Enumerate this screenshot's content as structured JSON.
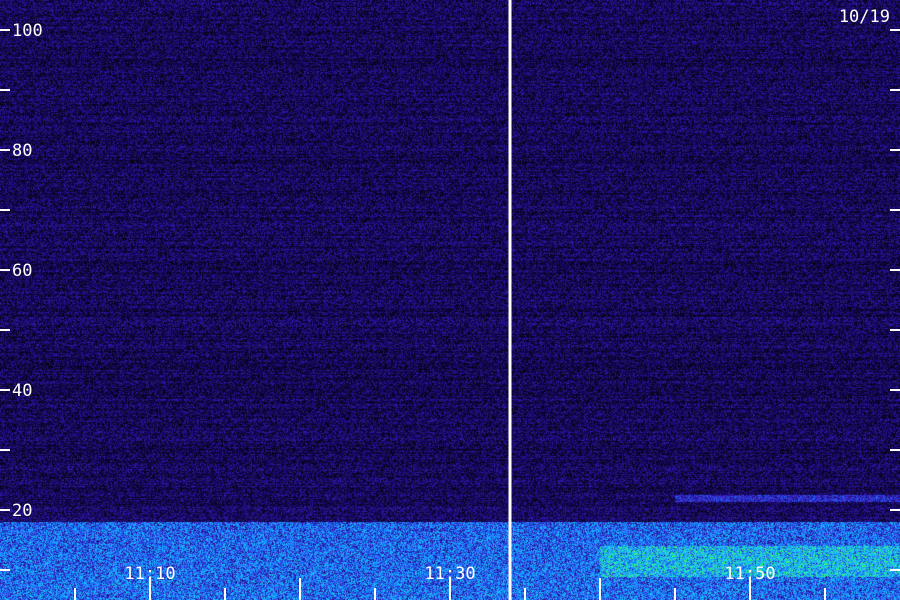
{
  "chart_data": {
    "type": "heatmap",
    "title": "",
    "date_label": "10/19",
    "xlabel": "",
    "ylabel": "",
    "x_tick_labels": [
      "11:10",
      "11:30",
      "11:50"
    ],
    "y_tick_labels": [
      "20",
      "40",
      "60",
      "80",
      "100"
    ],
    "y_ticks": [
      20,
      40,
      60,
      80,
      100
    ],
    "y_minor_ticks": [
      10,
      30,
      50,
      70,
      90
    ],
    "ylim": [
      5,
      105
    ],
    "x_major_ticks": [
      "11:10",
      "11:30",
      "11:50"
    ],
    "x_range": [
      "11:00",
      "12:00"
    ],
    "time_marker": "11:34",
    "colormap": [
      "#000000",
      "#1a0a6e",
      "#3a1cc0",
      "#1e6cff",
      "#18c8ff",
      "#39ff5a"
    ],
    "background_color": "#000000",
    "axis_color": "#ffffff",
    "bands": [
      {
        "name": "low-frequency noise (strong)",
        "y_from": 5,
        "y_to": 18,
        "x_from": "11:00",
        "x_to": "12:00",
        "level": 0.75
      },
      {
        "name": "green band",
        "y_from": 9,
        "y_to": 14,
        "x_from": "11:40",
        "x_to": "12:00",
        "level": 0.95
      },
      {
        "name": "blue line",
        "y_from": 21.5,
        "y_to": 22.5,
        "x_from": "11:45",
        "x_to": "12:00",
        "level": 0.55
      }
    ]
  }
}
